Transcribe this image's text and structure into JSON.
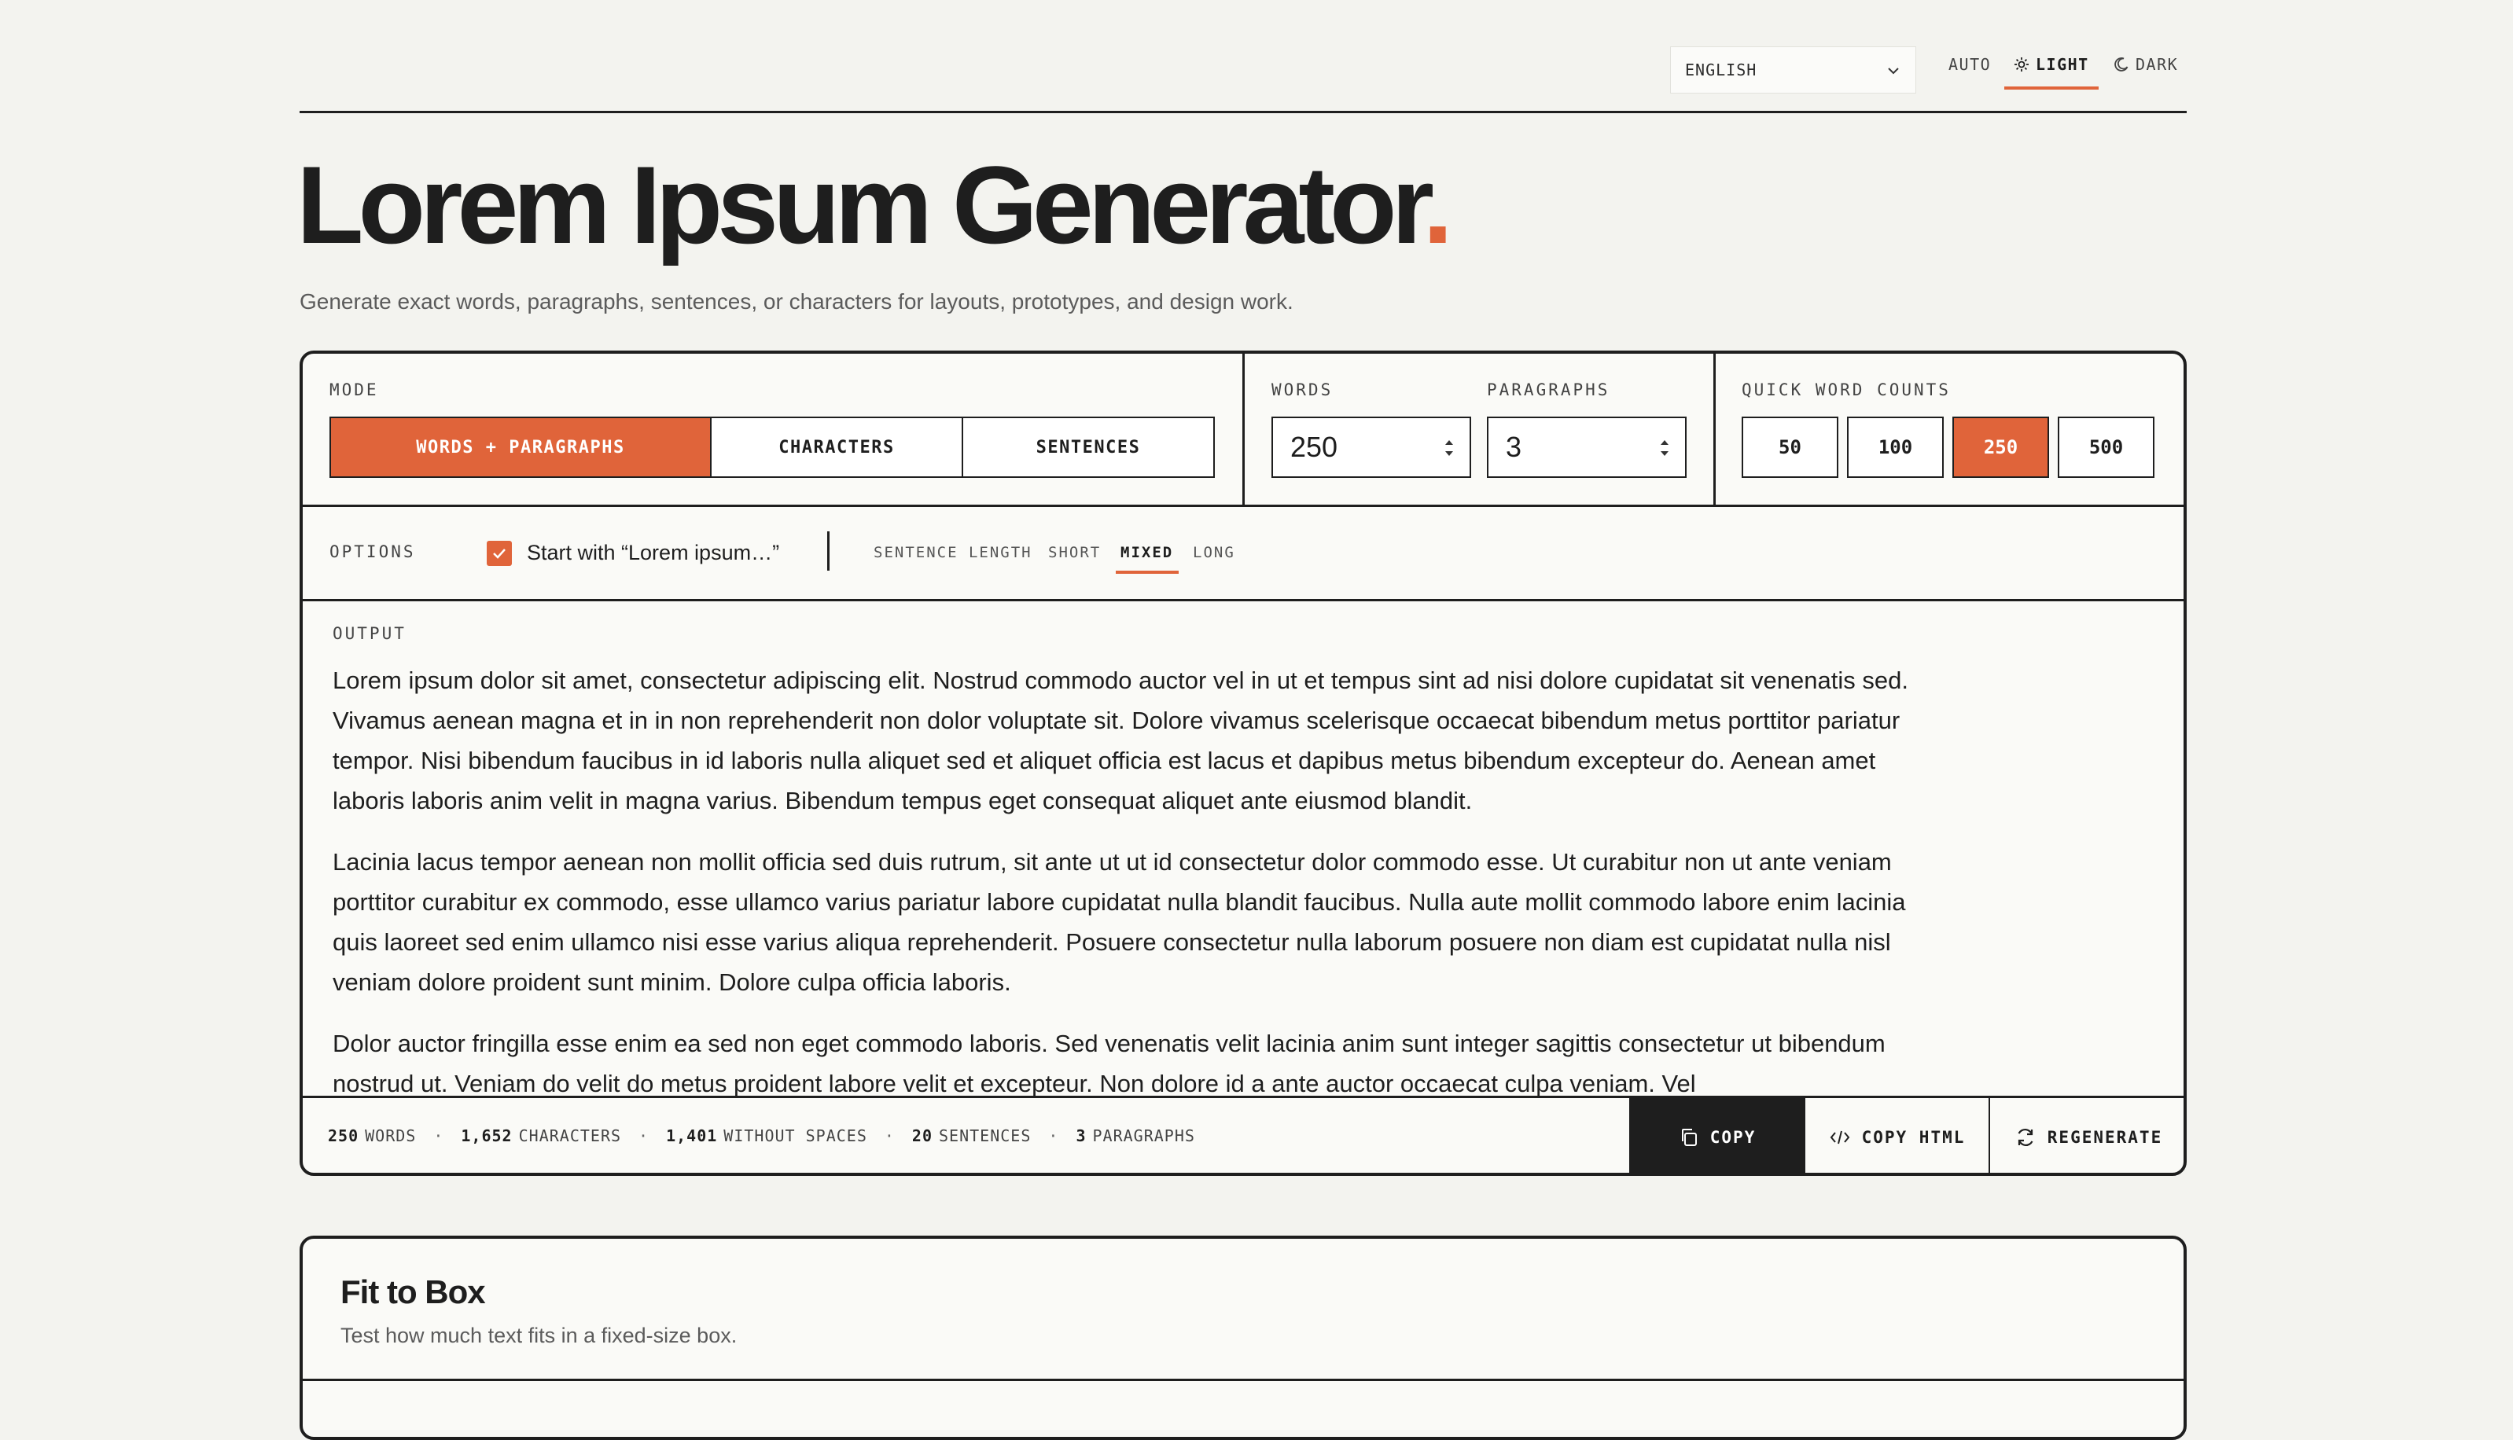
{
  "header": {
    "language": "ENGLISH",
    "theme_options": [
      "AUTO",
      "LIGHT",
      "DARK"
    ],
    "active_theme": "LIGHT"
  },
  "hero": {
    "title": "Lorem Ipsum Generator",
    "title_dot": ".",
    "subtitle": "Generate exact words, paragraphs, sentences, or characters for layouts, prototypes, and design work."
  },
  "generator": {
    "mode_label": "MODE",
    "modes": [
      "WORDS + PARAGRAPHS",
      "CHARACTERS",
      "SENTENCES"
    ],
    "active_mode": "WORDS + PARAGRAPHS",
    "words_label": "WORDS",
    "words_value": "250",
    "paragraphs_label": "PARAGRAPHS",
    "paragraphs_value": "3",
    "quick_label": "QUICK WORD COUNTS",
    "quick_counts": [
      "50",
      "100",
      "250",
      "500"
    ],
    "active_quick": "250",
    "options_label": "OPTIONS",
    "start_with_label": "Start with “Lorem ipsum…”",
    "start_with_checked": true,
    "sentence_length_label": "SENTENCE LENGTH",
    "sentence_lengths": [
      "SHORT",
      "MIXED",
      "LONG"
    ],
    "active_length": "MIXED",
    "output_label": "OUTPUT",
    "paragraphs": [
      "Lorem ipsum dolor sit amet, consectetur adipiscing elit. Nostrud commodo auctor vel in ut et tempus sint ad nisi dolore cupidatat sit venenatis sed. Vivamus aenean magna et in in non reprehenderit non dolor voluptate sit. Dolore vivamus scelerisque occaecat bibendum metus porttitor pariatur tempor. Nisi bibendum faucibus in id laboris nulla aliquet sed et aliquet officia est lacus et dapibus metus bibendum excepteur do. Aenean amet laboris laboris anim velit in magna varius. Bibendum tempus eget consequat aliquet ante eiusmod blandit.",
      "Lacinia lacus tempor aenean non mollit officia sed duis rutrum, sit ante ut ut id consectetur dolor commodo esse. Ut curabitur non ut ante veniam porttitor curabitur ex commodo, esse ullamco varius pariatur labore cupidatat nulla blandit faucibus. Nulla aute mollit commodo labore enim lacinia quis laoreet sed enim ullamco nisi esse varius aliqua reprehenderit. Posuere consectetur nulla laborum posuere non diam est cupidatat nulla nisl veniam dolore proident sunt minim. Dolore culpa officia laboris.",
      "Dolor auctor fringilla esse enim ea sed non eget commodo laboris. Sed venenatis velit lacinia anim sunt integer sagittis consectetur ut bibendum nostrud ut. Veniam do velit do metus proident labore velit et excepteur. Non dolore id a ante auctor occaecat culpa veniam. Vel"
    ],
    "stats": {
      "words_value": "250",
      "words_label": "WORDS",
      "chars_value": "1,652",
      "chars_label": "CHARACTERS",
      "nospace_value": "1,401",
      "nospace_label": "WITHOUT SPACES",
      "sentences_value": "20",
      "sentences_label": "SENTENCES",
      "paras_value": "3",
      "paras_label": "PARAGRAPHS",
      "separator": "·"
    },
    "actions": {
      "copy": "COPY",
      "copy_html": "COPY HTML",
      "regenerate": "REGENERATE"
    }
  },
  "fit_to_box": {
    "title": "Fit to Box",
    "description": "Test how much text fits in a fixed-size box."
  },
  "colors": {
    "accent": "#e0643a",
    "ink": "#1e1e1e",
    "background": "#f3f3ef"
  }
}
